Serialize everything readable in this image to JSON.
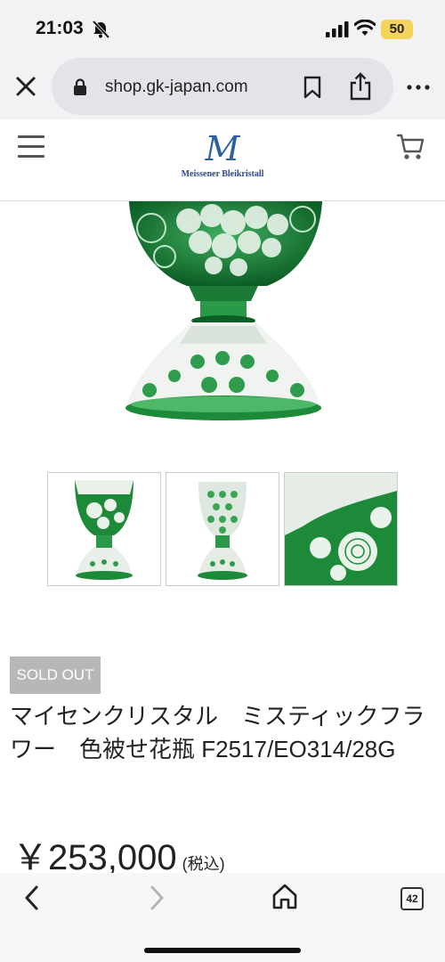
{
  "status_bar": {
    "time": "21:03",
    "battery": "50"
  },
  "browser": {
    "url": "shop.gk-japan.com",
    "tab_count": "42"
  },
  "site": {
    "logo_mark": "M",
    "logo_text": "Meissener Bleikristall"
  },
  "colors": {
    "accent_green": "#1d8a3a",
    "logo_blue": "#2b5fa6",
    "sold_out_bg": "#b7b7b7"
  },
  "product": {
    "badge": "SOLD OUT",
    "title": "マイセンクリスタル　ミスティックフラワー　色被せ花瓶 F2517/EO314/28G",
    "price": "￥253,000",
    "tax_note": "(税込)"
  },
  "icons": [
    "bell-muted-icon",
    "signal-icon",
    "wifi-icon",
    "close-icon",
    "lock-icon",
    "bookmark-icon",
    "share-icon",
    "more-icon",
    "hamburger-icon",
    "cart-icon",
    "back-icon",
    "forward-icon",
    "home-icon",
    "tabs-icon"
  ]
}
